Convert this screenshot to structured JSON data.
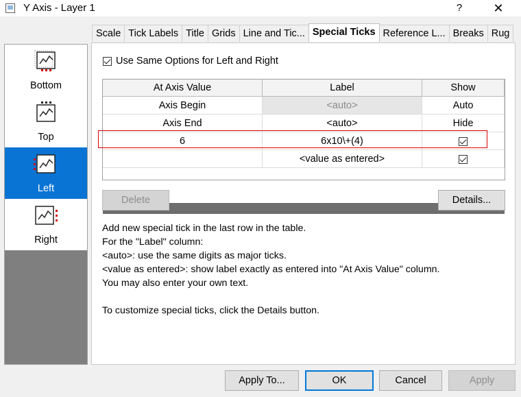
{
  "window": {
    "title": "Y Axis - Layer 1",
    "help": "?",
    "close": "✕"
  },
  "tabs": [
    {
      "label": "Scale"
    },
    {
      "label": "Tick Labels"
    },
    {
      "label": "Title"
    },
    {
      "label": "Grids"
    },
    {
      "label": "Line and Tic..."
    },
    {
      "label": "Special Ticks"
    },
    {
      "label": "Reference L..."
    },
    {
      "label": "Breaks"
    },
    {
      "label": "Rug"
    }
  ],
  "sidebar": {
    "items": [
      {
        "label": "Bottom"
      },
      {
        "label": "Top"
      },
      {
        "label": "Left"
      },
      {
        "label": "Right"
      }
    ],
    "selected": "Left"
  },
  "options": {
    "same_options_label": "Use Same Options for Left and Right",
    "same_options_checked": true
  },
  "table": {
    "headers": [
      "At Axis Value",
      "Label",
      "Show"
    ],
    "rows": [
      {
        "value": "Axis Begin",
        "label": "<auto>",
        "show": "Auto"
      },
      {
        "value": "Axis End",
        "label": "<auto>",
        "show": "Hide"
      },
      {
        "value": "6",
        "label": "6x10\\+(4)",
        "show": "checked"
      },
      {
        "value": "",
        "label": "<value as entered>",
        "show": "checked"
      }
    ]
  },
  "buttons": {
    "delete": "Delete",
    "details": "Details...",
    "apply_to": "Apply To...",
    "ok": "OK",
    "cancel": "Cancel",
    "apply": "Apply"
  },
  "info_lines": [
    "Add new special tick in the last row in the table.",
    "For the \"Label\" column:",
    "<auto>: use the same digits as major ticks.",
    "<value as entered>: show label exactly as entered into \"At Axis Value\" column.",
    "You may also enter your own text.",
    "",
    "To customize special ticks, click the Details button."
  ],
  "colors": {
    "selection": "#0a74d4",
    "highlight_border": "#e00000",
    "default_button_border": "#0078d7"
  },
  "icons": [
    "window-icon",
    "help-icon",
    "close-icon",
    "axis-icon",
    "checkbox-icon"
  ]
}
